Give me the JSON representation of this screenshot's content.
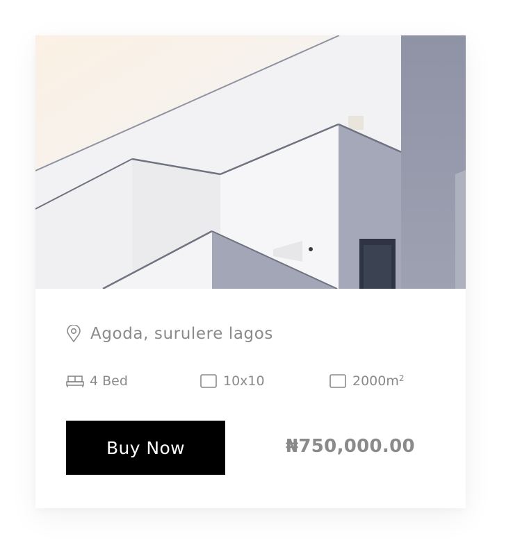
{
  "listing": {
    "location": "Agoda, surulere lagos",
    "features": {
      "bed": "4 Bed",
      "size": "10x10",
      "area": "2000m",
      "area_sup": "2"
    },
    "buy_label": "Buy Now",
    "price": "₦750,000.00"
  },
  "colors": {
    "button_bg": "#000000",
    "button_text": "#ffffff",
    "muted_text": "#8a8a8a",
    "card_bg": "#ffffff"
  },
  "icons": {
    "location": "map-pin-icon",
    "bed": "bed-icon",
    "size": "square-icon",
    "area": "square-icon"
  }
}
